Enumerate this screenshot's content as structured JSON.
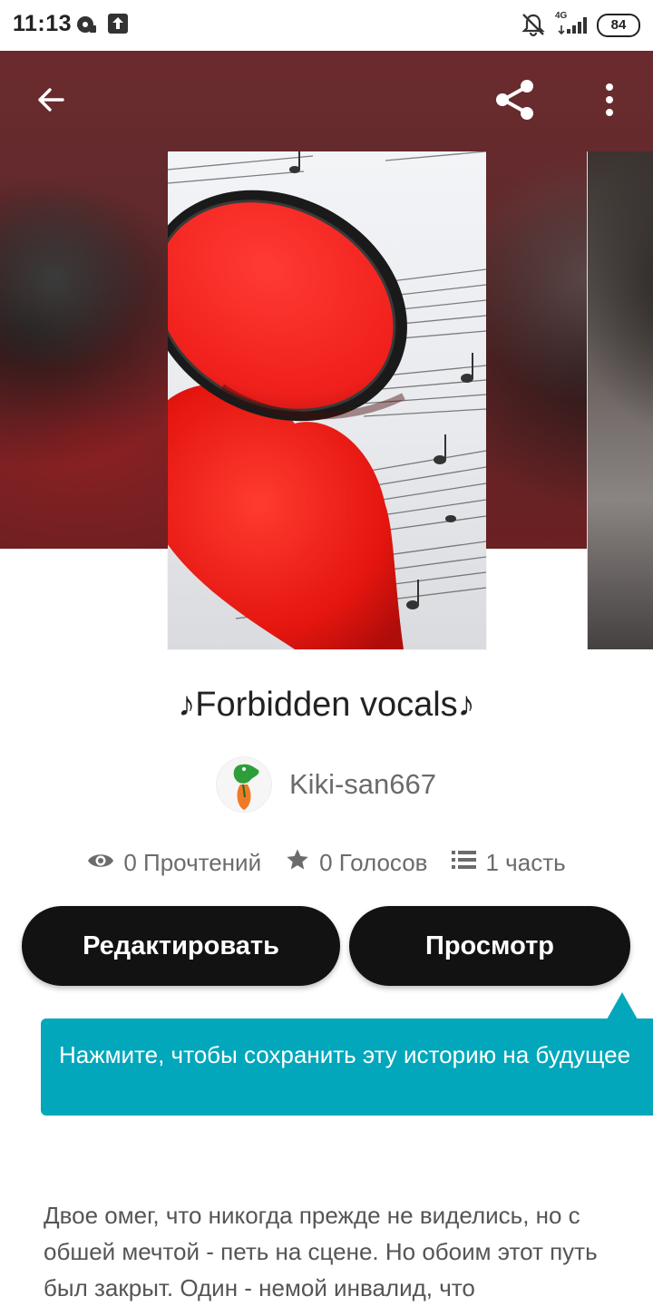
{
  "status_bar": {
    "time": "11:13",
    "network": "4G",
    "battery": "84",
    "icons": [
      "record-icon",
      "upload-icon",
      "bell-off-icon",
      "signal-icon",
      "battery-icon"
    ]
  },
  "header": {
    "back_icon": "arrow-left-icon",
    "share_icon": "share-icon",
    "more_icon": "more-vertical-icon"
  },
  "story": {
    "title": "♪Forbidden vocals♪",
    "author": "Kiki-san667",
    "stats": {
      "reads": "0 Прочтений",
      "votes": "0 Голосов",
      "parts": "1 часть"
    }
  },
  "actions": {
    "edit_label": "Редактировать",
    "preview_label": "Просмотр"
  },
  "tooltip": {
    "text": "Нажмите, чтобы сохранить эту историю на будущее"
  },
  "description": "Двое омег, что никогда прежде не виделись, но с обшей мечтой - петь на сцене. Но обоим этот путь был закрыт. Один - немой инвалид, что",
  "colors": {
    "banner": "#5f2a2c",
    "button": "#121212",
    "tooltip": "#02a7bb",
    "meta_text": "#6b6b6b"
  }
}
